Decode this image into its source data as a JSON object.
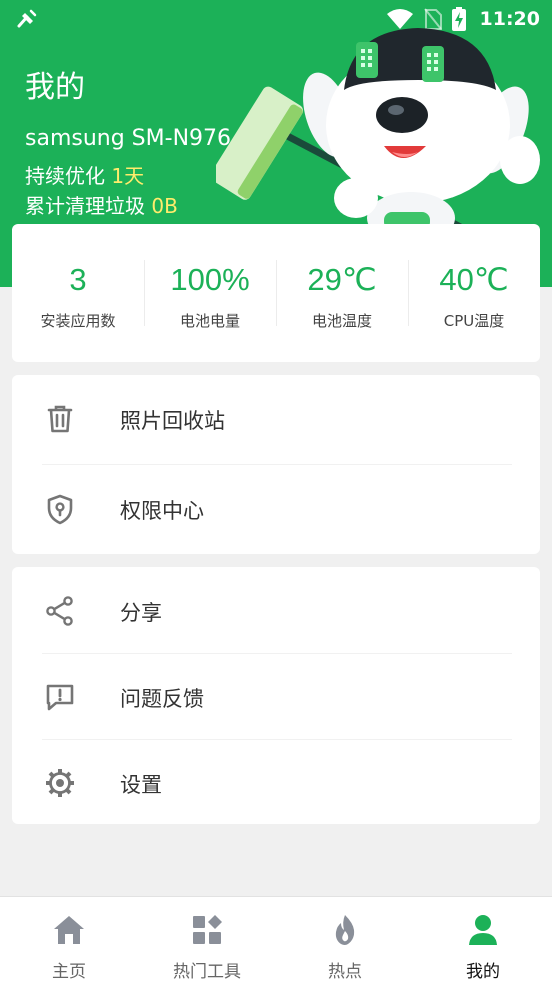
{
  "status_bar": {
    "time": "11:20"
  },
  "header": {
    "title": "我的",
    "device_name": "samsung SM-N976...",
    "optimization_prefix": "持续优化 ",
    "optimization_value": "1天",
    "cleaned_prefix": "累计清理垃圾 ",
    "cleaned_value": "0B"
  },
  "stats": [
    {
      "value": "3",
      "label": "安装应用数"
    },
    {
      "value": "100%",
      "label": "电池电量"
    },
    {
      "value": "29℃",
      "label": "电池温度"
    },
    {
      "value": "40℃",
      "label": "CPU温度"
    }
  ],
  "tools_menu": [
    {
      "label": "照片回收站",
      "icon": "trash-icon"
    },
    {
      "label": "权限中心",
      "icon": "shield-lock-icon"
    }
  ],
  "other_menu": [
    {
      "label": "分享",
      "icon": "share-icon"
    },
    {
      "label": "问题反馈",
      "icon": "feedback-icon"
    },
    {
      "label": "设置",
      "icon": "gear-icon"
    }
  ],
  "bottom_nav": [
    {
      "label": "主页",
      "icon": "home-icon",
      "active": false
    },
    {
      "label": "热门工具",
      "icon": "apps-grid-icon",
      "active": false
    },
    {
      "label": "热点",
      "icon": "flame-icon",
      "active": false
    },
    {
      "label": "我的",
      "icon": "person-icon",
      "active": true
    }
  ],
  "colors": {
    "brand_green": "#1cb158",
    "highlight_yellow": "#ffec6c",
    "active_nav": "#1cb158",
    "inactive_nav_icon": "#8a8f99"
  }
}
